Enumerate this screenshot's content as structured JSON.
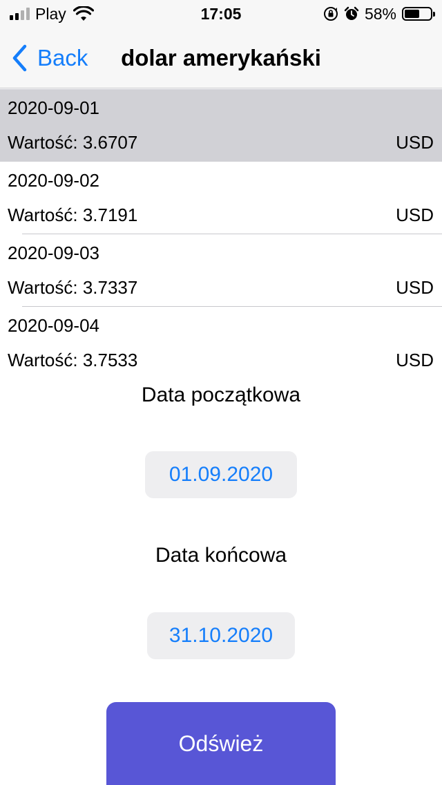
{
  "status_bar": {
    "carrier": "Play",
    "time": "17:05",
    "battery_percent": "58%",
    "battery_level": 0.58,
    "icons": [
      "signal-icon",
      "wifi-icon",
      "orientation-lock-icon",
      "alarm-icon",
      "battery-icon"
    ]
  },
  "nav": {
    "back_label": "Back",
    "title": "dolar amerykański"
  },
  "rates": [
    {
      "date": "2020-09-01",
      "value": "Wartość: 3.6707",
      "currency": "USD",
      "selected": true
    },
    {
      "date": "2020-09-02",
      "value": "Wartość: 3.7191",
      "currency": "USD",
      "selected": false
    },
    {
      "date": "2020-09-03",
      "value": "Wartość: 3.7337",
      "currency": "USD",
      "selected": false
    },
    {
      "date": "2020-09-04",
      "value": "Wartość: 3.7533",
      "currency": "USD",
      "selected": false
    }
  ],
  "form": {
    "start_label": "Data początkowa",
    "start_date": "01.09.2020",
    "end_label": "Data końcowa",
    "end_date": "31.10.2020",
    "refresh_label": "Odśwież"
  },
  "colors": {
    "accent": "#157efb",
    "button": "#5856d6",
    "selected_row": "#d1d1d6",
    "pill_bg": "#eeeef0"
  }
}
